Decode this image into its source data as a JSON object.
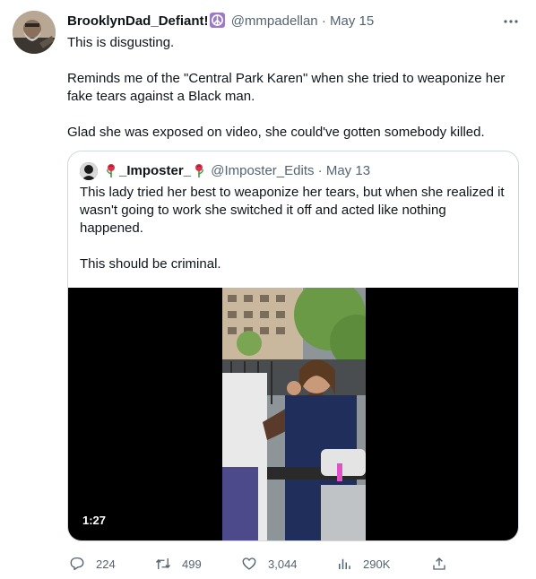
{
  "tweet": {
    "author_name": "BrooklynDad_Defiant!",
    "author_handle": "@mmpadellan",
    "separator": "·",
    "date": "May 15",
    "more_icon": "more-horizontal-icon",
    "paragraphs": [
      "This is disgusting.",
      "Reminds me of the \"Central Park Karen\" when she tried to weaponize her fake tears against a Black man.",
      "Glad she was exposed on video, she could've gotten somebody killed."
    ]
  },
  "quote": {
    "author_name": "_Imposter_",
    "author_handle": "@Imposter_Edits",
    "separator": "·",
    "date": "May 13",
    "paragraphs": [
      "This lady tried her best to weaponize her tears, but when she realized it wasn't going to work she switched it off and acted like nothing happened.",
      "This should be criminal."
    ],
    "video_duration": "1:27"
  },
  "actions": {
    "replies": "224",
    "retweets": "499",
    "likes": "3,044",
    "views": "290K"
  },
  "colors": {
    "text": "#0f1419",
    "secondary": "#536471",
    "border": "#cfd9de",
    "peace_badge": "#9b79c4"
  }
}
